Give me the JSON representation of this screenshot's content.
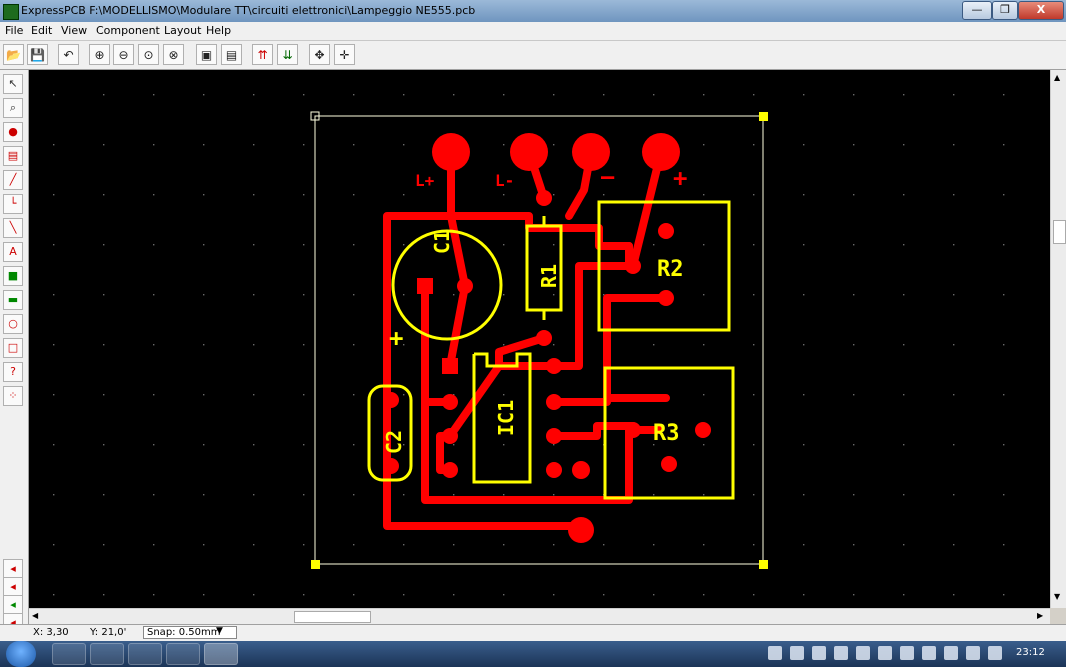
{
  "window": {
    "title": "ExpressPCB   F:\\MODELLISMO\\Modulare TT\\circuiti elettronici\\Lampeggio NE555.pcb",
    "minimize_label": "—",
    "maximize_label": "❐",
    "close_label": "X"
  },
  "menu": [
    "File",
    "Edit",
    "View",
    "Component",
    "Layout",
    "Help"
  ],
  "toolbar": {
    "open": "📂",
    "save": "💾",
    "undo": "↶",
    "zoom_in": "⊕",
    "zoom_out": "⊖",
    "zoom_fit": "⊙",
    "zoom_prev": "⊗",
    "props1": "▣",
    "props2": "▤",
    "top_layer": "⇈",
    "bottom_layer": "⇊",
    "move": "✥",
    "center": "✛"
  },
  "pcb_labels": {
    "l_plus": "L+",
    "l_minus": "L-",
    "minus": "—",
    "plus": "+",
    "c1": "C1",
    "c1_plus": "+",
    "r1": "R1",
    "r2": "R2",
    "r3": "R3",
    "ic1": "IC1",
    "c2": "C2"
  },
  "status": {
    "x": "X: 3,30",
    "y": "Y: 21,0'",
    "snap": "Snap: 0.50mm"
  },
  "clock": "23:12",
  "colors": {
    "copper": "#ff0000",
    "silkscreen": "#ffff00",
    "board_outline": "#ffffff",
    "background": "#000000"
  }
}
